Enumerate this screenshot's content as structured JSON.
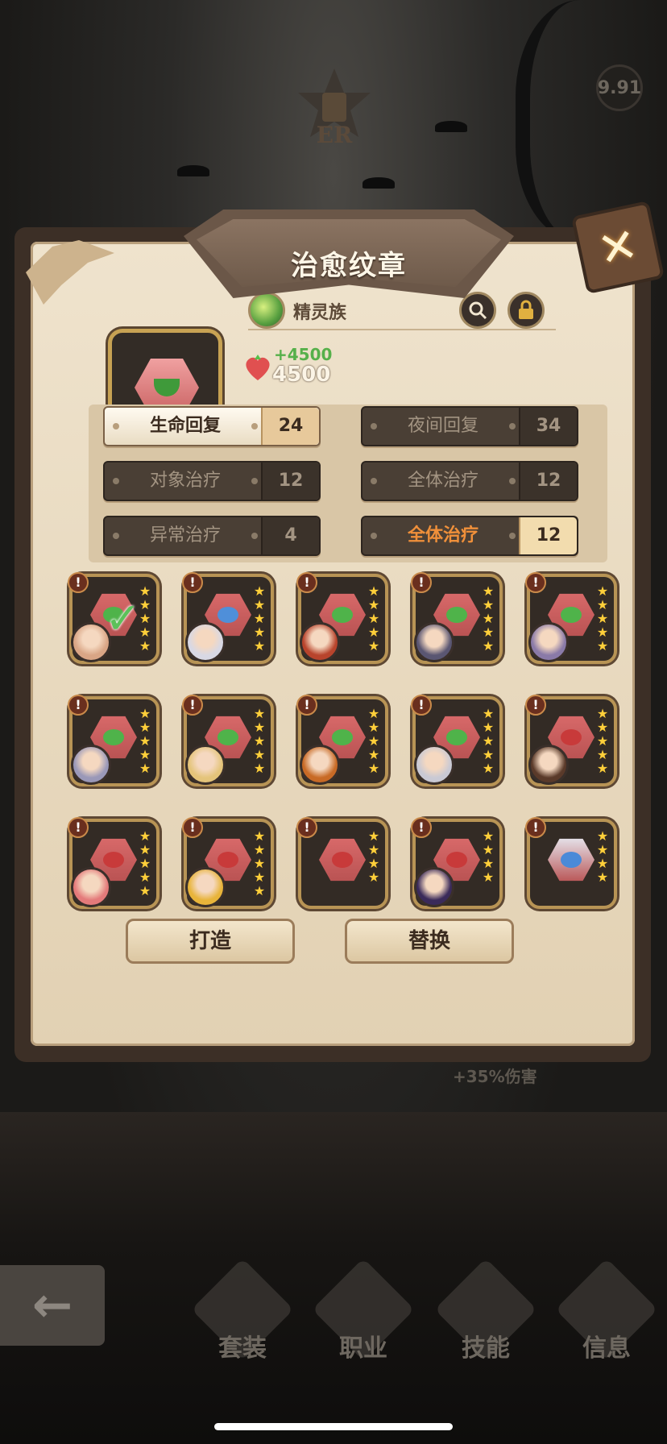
{
  "level_badge": "9.91",
  "dialog": {
    "title": "治愈纹章",
    "race_label": "精灵族",
    "stat_bonus": "+4500",
    "stat_value": "4500",
    "close_symbol": "✕"
  },
  "attributes": [
    {
      "name": "生命回复",
      "value": "24",
      "style": "light"
    },
    {
      "name": "夜间回复",
      "value": "34",
      "style": "dark"
    },
    {
      "name": "对象治疗",
      "value": "12",
      "style": "dark"
    },
    {
      "name": "全体治疗",
      "value": "12",
      "style": "dark"
    },
    {
      "name": "异常治疗",
      "value": "4",
      "style": "dark"
    },
    {
      "name": "全体治疗",
      "value": "12",
      "style": "accent"
    }
  ],
  "items": [
    {
      "hex_color": "#d96a6a",
      "core_color": "#4fb34a",
      "avatar_color": "#d9a585",
      "stars": 5,
      "checked": true
    },
    {
      "hex_color": "#d96a6a",
      "core_color": "#4f8fd9",
      "avatar_color": "#d8d8e4",
      "stars": 5,
      "checked": false
    },
    {
      "hex_color": "#d96a6a",
      "core_color": "#4fb34a",
      "avatar_color": "#b8442c",
      "stars": 5,
      "checked": false
    },
    {
      "hex_color": "#d96a6a",
      "core_color": "#4fb34a",
      "avatar_color": "#5a5672",
      "stars": 5,
      "checked": false
    },
    {
      "hex_color": "#d96a6a",
      "core_color": "#4fb34a",
      "avatar_color": "#8a7aa8",
      "stars": 5,
      "checked": false
    },
    {
      "hex_color": "#d96a6a",
      "core_color": "#4fb34a",
      "avatar_color": "#9a98b8",
      "stars": 5,
      "checked": false
    },
    {
      "hex_color": "#d96a6a",
      "core_color": "#4fb34a",
      "avatar_color": "#e4c47a",
      "stars": 5,
      "checked": false
    },
    {
      "hex_color": "#d96a6a",
      "core_color": "#4fb34a",
      "avatar_color": "#c86a26",
      "stars": 5,
      "checked": false
    },
    {
      "hex_color": "#d96a6a",
      "core_color": "#4fb34a",
      "avatar_color": "#c9c9d4",
      "stars": 5,
      "checked": false
    },
    {
      "hex_color": "#d96a6a",
      "core_color": "#c83a3a",
      "avatar_color": "#5a3a2a",
      "stars": 5,
      "checked": false
    },
    {
      "hex_color": "#d96a6a",
      "core_color": "#c83a3a",
      "avatar_color": "#e47a7a",
      "stars": 5,
      "checked": false
    },
    {
      "hex_color": "#d96a6a",
      "core_color": "#c83a3a",
      "avatar_color": "#e8b43a",
      "stars": 5,
      "checked": false
    },
    {
      "hex_color": "#d96a6a",
      "core_color": "#c83a3a",
      "avatar_color": "",
      "stars": 4,
      "checked": false
    },
    {
      "hex_color": "#d96a6a",
      "core_color": "#c83a3a",
      "avatar_color": "#3a2a5a",
      "stars": 4,
      "checked": false
    },
    {
      "hex_color": "#e6e6ee",
      "core_color": "#4a8ad8",
      "avatar_color": "",
      "stars": 4,
      "checked": false
    }
  ],
  "buttons": {
    "forge": "打造",
    "replace": "替换"
  },
  "peek_text": "+35%伤害",
  "nav": [
    {
      "id": "set",
      "label": "套装"
    },
    {
      "id": "class",
      "label": "职业"
    },
    {
      "id": "skill",
      "label": "技能"
    },
    {
      "id": "info",
      "label": "信息"
    }
  ],
  "colors": {
    "accent": "#f0903a",
    "gold_border": "#c7a253",
    "dialog_bg": "#e7d8bd"
  }
}
